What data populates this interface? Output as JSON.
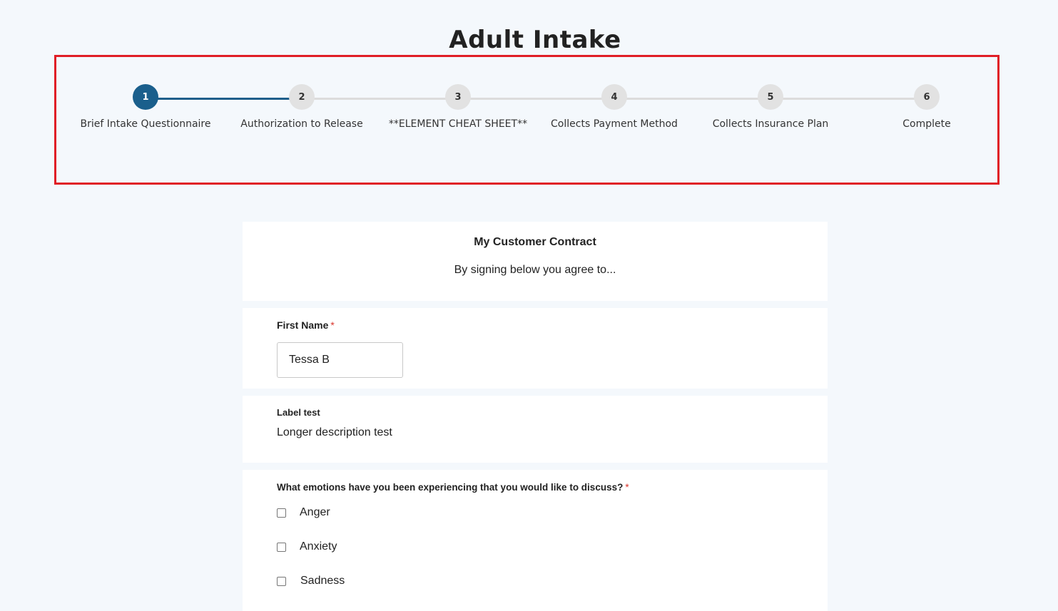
{
  "header": {
    "title": "Adult Intake"
  },
  "stepper": {
    "steps": [
      {
        "number": "1",
        "label": "Brief Intake Questionnaire",
        "active": true
      },
      {
        "number": "2",
        "label": "Authorization to Release",
        "active": false
      },
      {
        "number": "3",
        "label": "**ELEMENT CHEAT SHEET**",
        "active": false
      },
      {
        "number": "4",
        "label": "Collects Payment Method",
        "active": false
      },
      {
        "number": "5",
        "label": "Collects Insurance Plan",
        "active": false
      },
      {
        "number": "6",
        "label": "Complete",
        "active": false
      }
    ],
    "colors": {
      "active": "#1a5f8c",
      "inactive": "#e2e2e2",
      "highlight_border": "#e01e26"
    }
  },
  "contract": {
    "title": "My Customer Contract",
    "text": "By signing below you agree to..."
  },
  "first_name": {
    "label": "First Name",
    "required_mark": "*",
    "value": "Tessa B"
  },
  "label_test": {
    "label": "Label test",
    "description": "Longer description test"
  },
  "emotions": {
    "question": "What emotions have you been experiencing that you would like to discuss?",
    "required_mark": "*",
    "options": [
      {
        "label": "Anger",
        "checked": false
      },
      {
        "label": "Anxiety",
        "checked": false
      },
      {
        "label": "Sadness",
        "checked": false
      }
    ]
  }
}
